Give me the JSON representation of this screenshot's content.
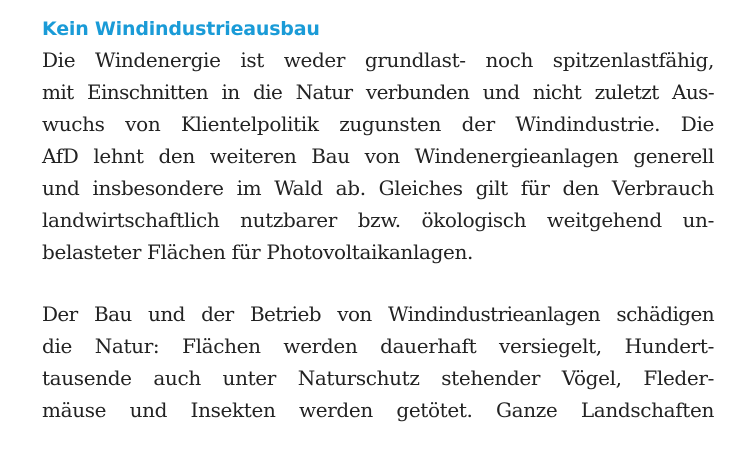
{
  "section": {
    "heading": "Kein Windindustrieausbau",
    "paragraphs": [
      {
        "lines": [
          "Die Windenergie ist weder grundlast- noch spitzenlastfähig,",
          "mit Einschnitten in die Natur verbunden und nicht zuletzt Aus-",
          "wuchs von Klientelpolitik zugunsten der Windindustrie. Die",
          "AfD lehnt den weiteren Bau von Windenergieanlagen generell",
          "und insbesondere im Wald ab. Gleiches gilt für den Verbrauch",
          "landwirtschaftlich nutzbarer bzw. ökologisch weitgehend un-",
          "belasteter Flächen für Photovoltaikanlagen."
        ]
      },
      {
        "lines": [
          "Der Bau und der Betrieb von Windindustrieanlagen schädigen",
          "die Natur: Flächen werden dauerhaft versiegelt, Hundert-",
          "tausende auch unter Naturschutz stehender Vögel, Fleder-",
          "mäuse und Insekten werden getötet. Ganze Landschaften"
        ]
      }
    ]
  }
}
